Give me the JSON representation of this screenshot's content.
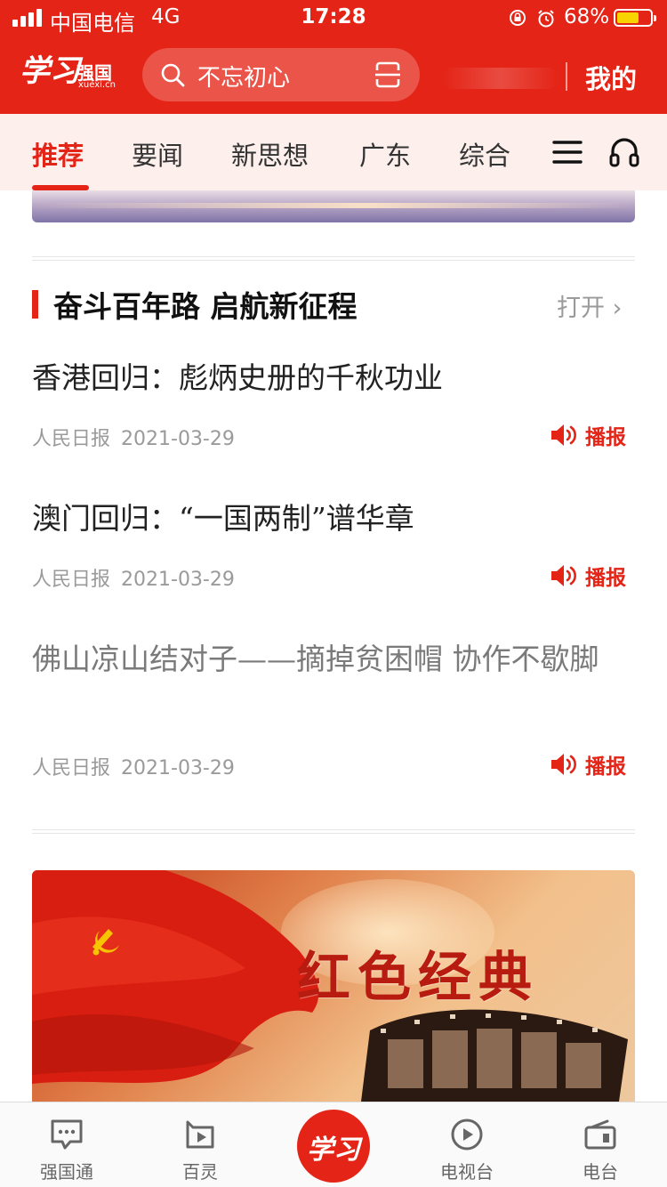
{
  "status_bar": {
    "carrier": "中国电信",
    "network": "4G",
    "time": "17:28",
    "battery": "68%",
    "battery_level": 0.68,
    "icons": [
      "signal-icon",
      "rotation-lock-icon",
      "alarm-icon",
      "battery-icon"
    ]
  },
  "header": {
    "logo_script": "学习",
    "logo_name": "强国",
    "logo_url": "xuexi.cn",
    "search_placeholder": "不忘初心",
    "mine_label": "我的",
    "brand_color": "#e42417"
  },
  "tabs": [
    {
      "label": "推荐",
      "active": true
    },
    {
      "label": "要闻",
      "active": false
    },
    {
      "label": "新思想",
      "active": false
    },
    {
      "label": "广东",
      "active": false
    },
    {
      "label": "综合",
      "active": false
    }
  ],
  "section": {
    "title": "奋斗百年路 启航新征程",
    "open_label": "打开"
  },
  "articles": [
    {
      "title": "香港回归：彪炳史册的千秋功业",
      "source": "人民日报",
      "date": "2021-03-29",
      "broadcast_label": "播报"
    },
    {
      "title": "澳门回归：“一国两制”谱华章",
      "source": "人民日报",
      "date": "2021-03-29",
      "broadcast_label": "播报"
    },
    {
      "title": "佛山凉山结对子——摘掉贫困帽 协作不歇脚",
      "source": "人民日报",
      "date": "2021-03-29",
      "broadcast_label": "播报"
    }
  ],
  "promo": {
    "title": "红色经典"
  },
  "bottom_nav": {
    "items": [
      {
        "label": "强国通",
        "icon": "chat-bubble-icon"
      },
      {
        "label": "百灵",
        "icon": "video-play-icon"
      },
      {
        "label": "电视台",
        "icon": "play-circle-icon"
      },
      {
        "label": "电台",
        "icon": "radio-icon"
      }
    ],
    "center_label": "学习"
  }
}
